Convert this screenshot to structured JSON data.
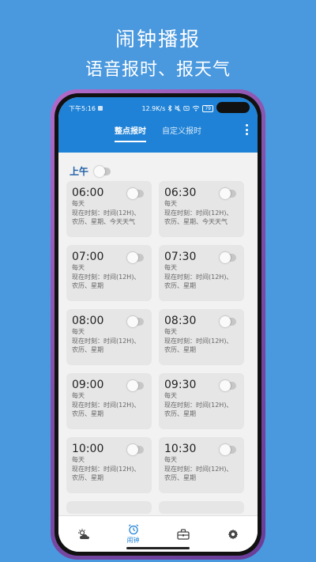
{
  "promo": {
    "title": "闹钟播报",
    "subtitle": "语音报时、报天气"
  },
  "status_bar": {
    "time": "下午5:16",
    "network_speed": "12.9K/s",
    "battery": "79"
  },
  "tabs": [
    {
      "label": "整点报时",
      "active": true
    },
    {
      "label": "自定义报时",
      "active": false
    }
  ],
  "section": {
    "label": "上午",
    "enabled": false
  },
  "alarms": [
    {
      "time": "06:00",
      "enabled": false,
      "line1": "每天",
      "line2": "现在时刻：时间(12H)、",
      "line3": "农历、星期、今天天气"
    },
    {
      "time": "06:30",
      "enabled": false,
      "line1": "每天",
      "line2": "现在时刻：时间(12H)、",
      "line3": "农历、星期、今天天气"
    },
    {
      "time": "07:00",
      "enabled": false,
      "line1": "每天",
      "line2": "现在时刻：时间(12H)、",
      "line3": "农历、星期"
    },
    {
      "time": "07:30",
      "enabled": false,
      "line1": "每天",
      "line2": "现在时刻：时间(12H)、",
      "line3": "农历、星期"
    },
    {
      "time": "08:00",
      "enabled": false,
      "line1": "每天",
      "line2": "现在时刻：时间(12H)、",
      "line3": "农历、星期"
    },
    {
      "time": "08:30",
      "enabled": false,
      "line1": "每天",
      "line2": "现在时刻：时间(12H)、",
      "line3": "农历、星期"
    },
    {
      "time": "09:00",
      "enabled": false,
      "line1": "每天",
      "line2": "现在时刻：时间(12H)、",
      "line3": "农历、星期"
    },
    {
      "time": "09:30",
      "enabled": false,
      "line1": "每天",
      "line2": "现在时刻：时间(12H)、",
      "line3": "农历、星期"
    },
    {
      "time": "10:00",
      "enabled": false,
      "line1": "每天",
      "line2": "现在时刻：时间(12H)、",
      "line3": "农历、星期"
    },
    {
      "time": "10:30",
      "enabled": false,
      "line1": "每天",
      "line2": "现在时刻：时间(12H)、",
      "line3": "农历、星期"
    }
  ],
  "bottom_nav": [
    {
      "icon": "weather-icon",
      "label": ""
    },
    {
      "icon": "alarm-clock-icon",
      "label": "闹钟"
    },
    {
      "icon": "toolbox-icon",
      "label": ""
    },
    {
      "icon": "gear-icon",
      "label": ""
    }
  ],
  "colors": {
    "background": "#4a98de",
    "app_bar": "#1f82d6",
    "card": "#e6e6e6",
    "accent": "#1f82d6",
    "section_label": "#1f5fa6"
  }
}
